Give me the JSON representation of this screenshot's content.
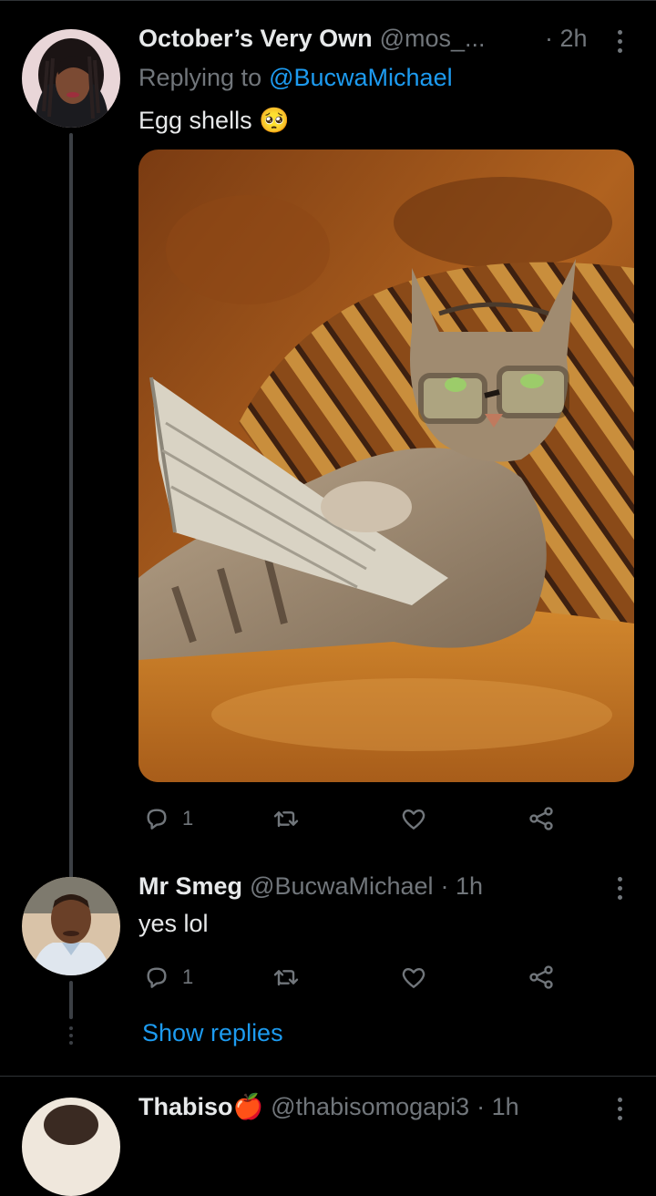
{
  "tweet1": {
    "display_name": "October’s Very Own",
    "handle": "@mos_...",
    "time": "· 2h",
    "replying_prefix": "Replying to",
    "replying_handle": "@BucwaMichael",
    "text": "Egg shells 🥺",
    "reply_count": "1"
  },
  "tweet2": {
    "display_name": "Mr Smeg",
    "handle": "@BucwaMichael",
    "time": "· 1h",
    "text": "yes lol",
    "reply_count": "1",
    "show_replies": "Show replies"
  },
  "tweet3": {
    "display_name": "Thabiso🍎",
    "handle": "@thabisomogapi3",
    "time": "· 1h"
  },
  "colors": {
    "background": "#000000",
    "primary_text": "#e7e9ea",
    "secondary_text": "#71767b",
    "link": "#1d9bf0",
    "thread_line": "#3b3f44"
  },
  "icons": [
    "more-vertical-icon",
    "reply-icon",
    "retweet-icon",
    "like-icon",
    "share-icon"
  ]
}
